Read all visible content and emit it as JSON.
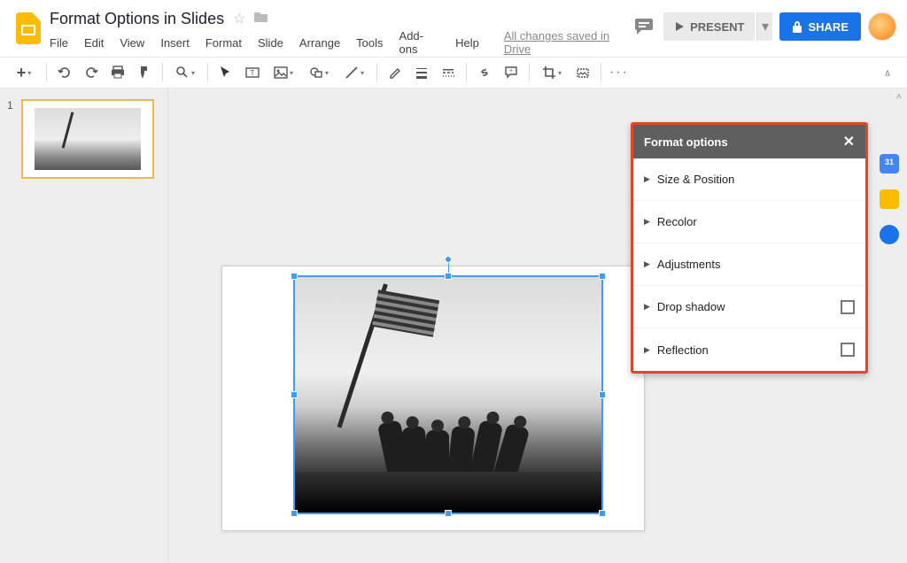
{
  "header": {
    "doc_title": "Format Options in Slides",
    "menus": [
      "File",
      "Edit",
      "View",
      "Insert",
      "Format",
      "Slide",
      "Arrange",
      "Tools",
      "Add-ons",
      "Help"
    ],
    "save_msg": "All changes saved in Drive",
    "present_label": "PRESENT",
    "share_label": "SHARE"
  },
  "filmstrip": {
    "slides": [
      {
        "number": "1"
      }
    ]
  },
  "panel": {
    "title": "Format options",
    "rows": [
      {
        "label": "Size & Position",
        "checkbox": false
      },
      {
        "label": "Recolor",
        "checkbox": false
      },
      {
        "label": "Adjustments",
        "checkbox": false
      },
      {
        "label": "Drop shadow",
        "checkbox": true
      },
      {
        "label": "Reflection",
        "checkbox": true
      }
    ]
  }
}
